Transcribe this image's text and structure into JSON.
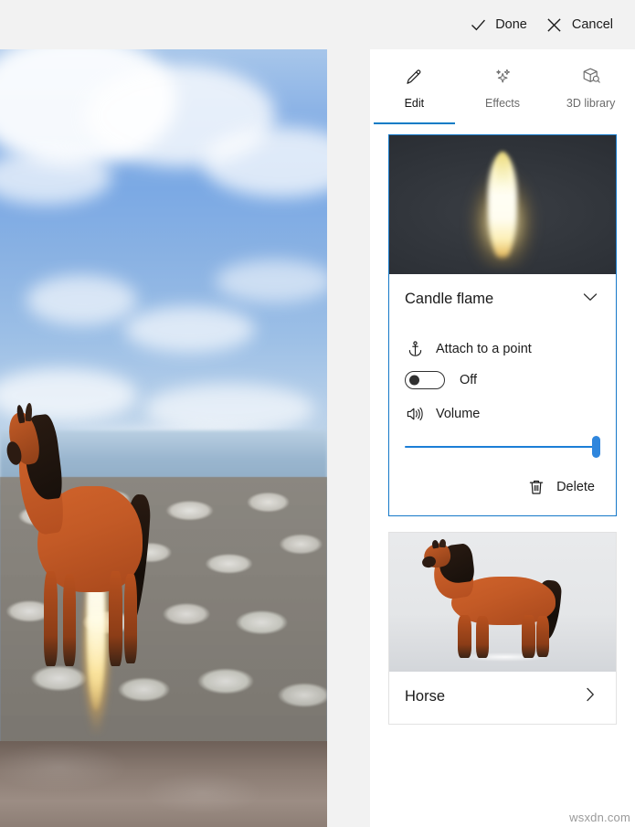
{
  "topbar": {
    "done_label": "Done",
    "done_icon": "checkmark-icon",
    "cancel_label": "Cancel",
    "cancel_icon": "close-x-icon"
  },
  "tabs": [
    {
      "label": "Edit",
      "icon": "pencil-icon",
      "active": true
    },
    {
      "label": "Effects",
      "icon": "sparkles-icon",
      "active": false
    },
    {
      "label": "3D library",
      "icon": "cube-search-icon",
      "active": false
    }
  ],
  "cards": [
    {
      "title": "Candle flame",
      "selected": true,
      "expanded": true,
      "collapse_icon": "chevron-down-icon",
      "attach": {
        "icon": "anchor-icon",
        "label": "Attach to a point",
        "state_label": "Off",
        "state_on": false
      },
      "volume": {
        "icon": "speaker-volume-icon",
        "label": "Volume",
        "value": 100,
        "min": 0,
        "max": 100
      },
      "delete": {
        "icon": "trash-icon",
        "label": "Delete"
      }
    },
    {
      "title": "Horse",
      "selected": false,
      "expanded": false,
      "expand_icon": "chevron-right-icon"
    }
  ],
  "preview": {
    "scene_description": "video preview with horse 3D model and candle flame effect over gannet colony"
  },
  "watermark": "wsxdn.com",
  "colors": {
    "accent": "#0a7cc6",
    "selection_border": "#1578c8",
    "slider": "#1c7ed6",
    "slider_thumb": "#2f86dd",
    "chrome_bg": "#f2f2f2",
    "panel_bg": "#ffffff",
    "text": "#1c1c1c"
  }
}
